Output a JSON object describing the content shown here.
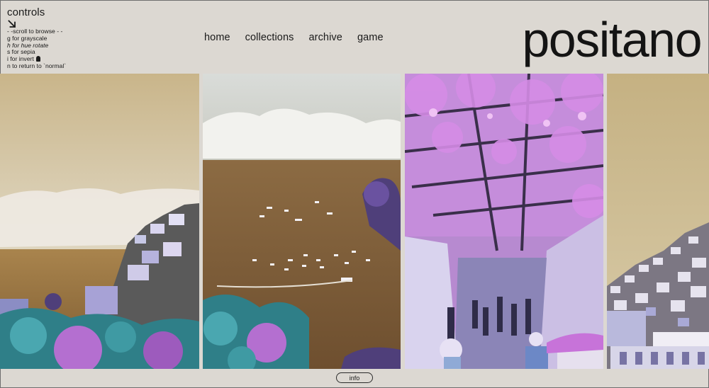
{
  "controls": {
    "title": "controls",
    "arrow_icon": "arrow-down-right-icon",
    "items": [
      "- -scroll to browse - -",
      "g for grayscale",
      "h for hue rotate",
      "s for sepia",
      "i for invert",
      "n to return to `normal`"
    ]
  },
  "nav": {
    "items": [
      "home",
      "collections",
      "archive",
      "game"
    ]
  },
  "site": {
    "title": "positano"
  },
  "footer": {
    "info_label": "info"
  },
  "colors": {
    "background": "#dcd8d2",
    "text": "#1a1a1a",
    "sepia_sky": "#cbb98e",
    "sea_brown": "#8a6a3e",
    "flower_purple": "#b46fd0",
    "flower_teal": "#3f9aa3"
  }
}
